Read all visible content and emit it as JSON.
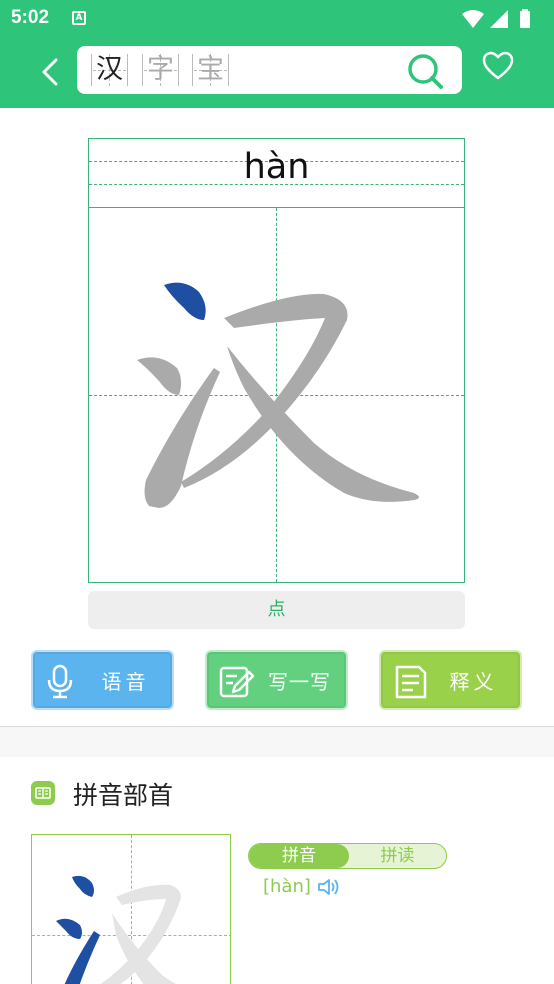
{
  "status_bar": {
    "time": "5:02",
    "notification_icon": "A"
  },
  "header": {
    "search_chars": [
      "汉",
      "字",
      "宝"
    ],
    "icons": {
      "back": "chevron-left-icon",
      "search": "search-icon",
      "favorite": "heart-icon"
    }
  },
  "character": {
    "glyph": "汉",
    "pinyin": "hàn",
    "current_stroke": "点"
  },
  "actions": [
    {
      "label": "语音",
      "icon": "microphone-icon",
      "color": "#5bb4ee"
    },
    {
      "label": "写一写",
      "icon": "write-icon",
      "color": "#62d07e"
    },
    {
      "label": "释义",
      "icon": "document-icon",
      "color": "#9ad14a"
    }
  ],
  "section": {
    "title": "拼音部首",
    "tabs": [
      "拼音",
      "拼读"
    ],
    "active_tab": "拼音",
    "reading": "[hàn]"
  },
  "colors": {
    "brand": "#2ec47a",
    "grid": "#3ab37a",
    "stroke_active": "#1f4fa3",
    "stroke_pending": "#aaaaaa",
    "section_accent": "#8dcc4e"
  }
}
